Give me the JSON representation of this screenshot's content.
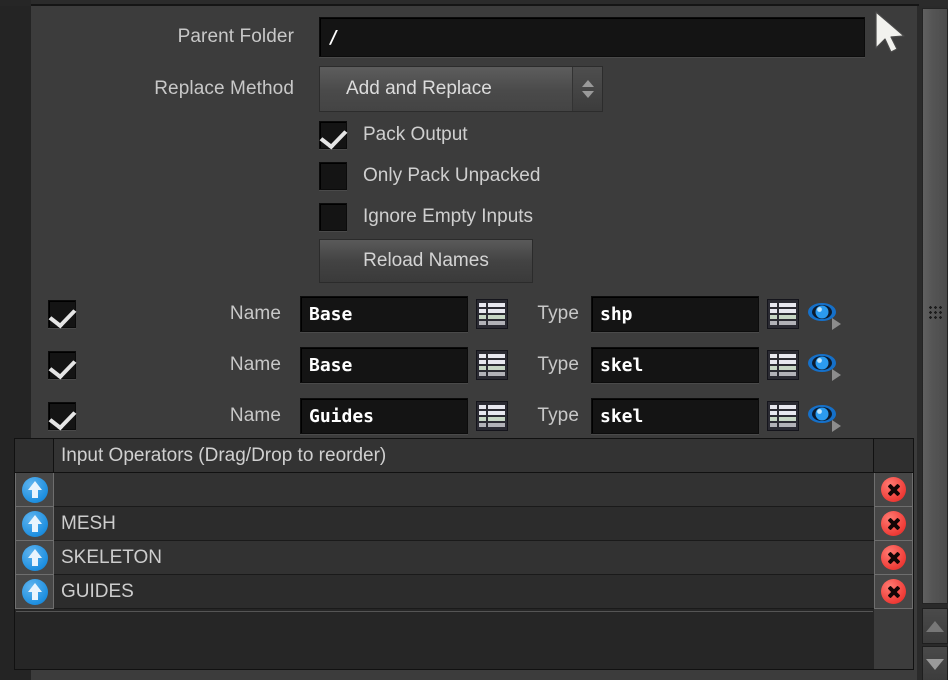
{
  "panel": {
    "parent_folder": {
      "label": "Parent Folder",
      "value": "/"
    },
    "replace_method": {
      "label": "Replace Method",
      "value": "Add and Replace"
    },
    "checkboxes": [
      {
        "label": "Pack Output",
        "checked": true
      },
      {
        "label": "Only Pack Unpacked",
        "checked": false
      },
      {
        "label": "Ignore Empty Inputs",
        "checked": false
      }
    ],
    "reload_button": {
      "label": "Reload Names"
    },
    "entries": [
      {
        "enabled": true,
        "name_label": "Name",
        "name_value": "Base",
        "type_label": "Type",
        "type_value": "shp"
      },
      {
        "enabled": true,
        "name_label": "Name",
        "name_value": "Base",
        "type_label": "Type",
        "type_value": "skel"
      },
      {
        "enabled": true,
        "name_label": "Name",
        "name_value": "Guides",
        "type_label": "Type",
        "type_value": "skel"
      }
    ]
  },
  "input_operators": {
    "header": "Input Operators (Drag/Drop to reorder)",
    "rows": [
      {
        "label": ""
      },
      {
        "label": "MESH"
      },
      {
        "label": "SKELETON"
      },
      {
        "label": "GUIDES"
      }
    ],
    "icons": {
      "reorder": "up-arrow-circle-icon",
      "delete": "delete-circle-icon"
    }
  },
  "icons": {
    "menu_list": "list-menu-icon",
    "visibility": "eye-icon",
    "cursor": "mouse-cursor",
    "spinner_up": "triangle-up-icon",
    "spinner_down": "triangle-down-icon"
  },
  "colors": {
    "panel_bg": "#3c3c3c",
    "field_bg": "#141414",
    "accent_blue": "#1e8fe0",
    "accent_red": "#ef3b36",
    "text": "#cfcfcf"
  }
}
